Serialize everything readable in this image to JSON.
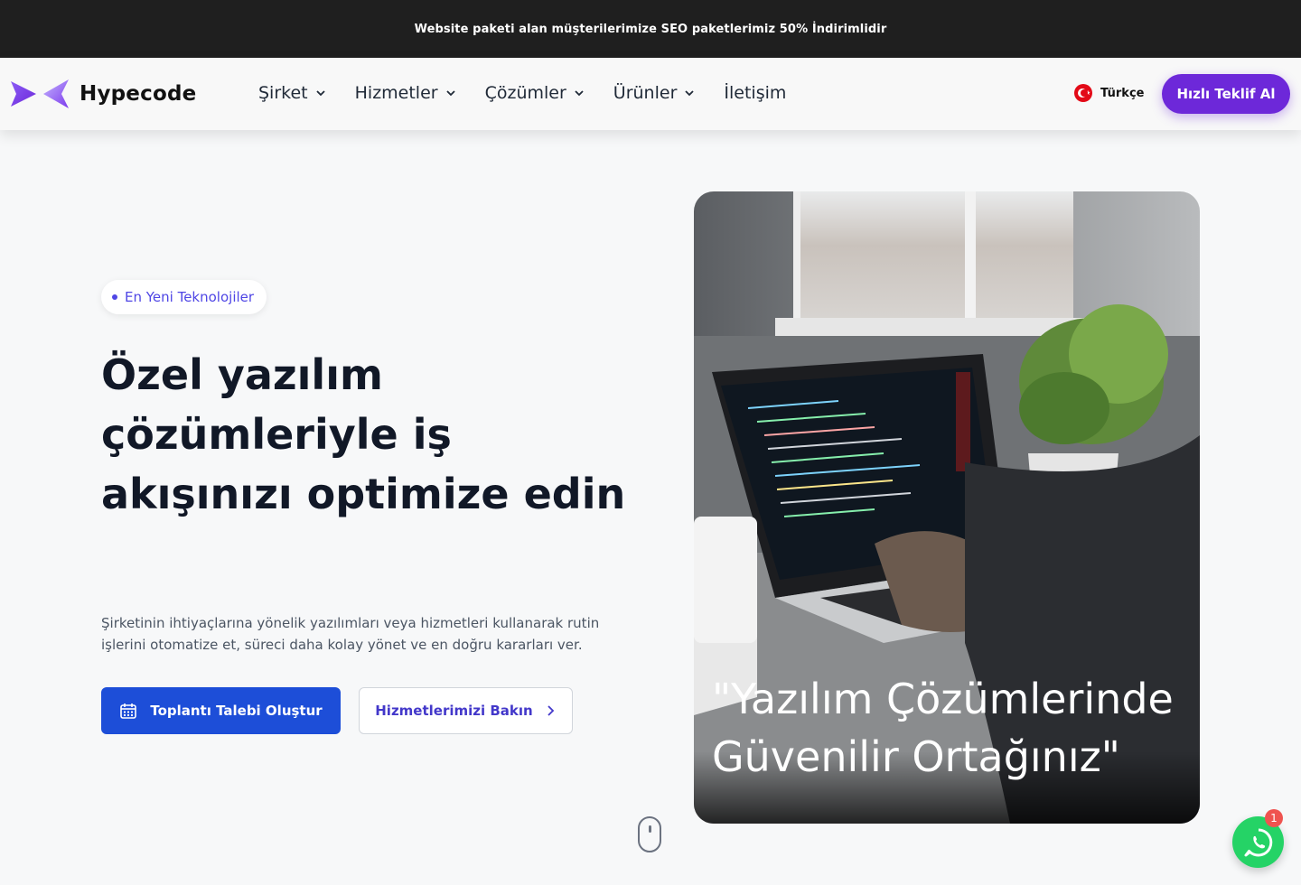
{
  "promo": {
    "text": "Website paketi alan müşterilerimize SEO paketlerimiz 50% İndirimlidir"
  },
  "header": {
    "brand": "Hypecode",
    "menu": [
      {
        "label": "Şirket",
        "has_dropdown": true
      },
      {
        "label": "Hizmetler",
        "has_dropdown": true
      },
      {
        "label": "Çözümler",
        "has_dropdown": true
      },
      {
        "label": "Ürünler",
        "has_dropdown": true
      },
      {
        "label": "İletişim",
        "has_dropdown": false
      }
    ],
    "language": "Türkçe",
    "cta": "Hızlı Teklif Al"
  },
  "hero": {
    "badge": "En Yeni Teknolojiler",
    "title": "Özel yazılım çözümleriyle iş akışınızı optimize edin",
    "description": "Şirketinin ihtiyaçlarına yönelik yazılımları veya hizmetleri kullanarak rutin işlerini otomatize et, süreci daha kolay yönet ve en doğru kararları ver.",
    "primary_button": "Toplantı Talebi Oluştur",
    "secondary_button": "Hizmetlerimizi Bakın",
    "quote": "\"Yazılım Çözümlerinde Güvenilir Ortağınız\""
  },
  "whatsapp": {
    "badge_count": "1"
  },
  "colors": {
    "accent_purple": "#6d28d9",
    "primary_blue": "#1d4ed8",
    "promo_bg": "#1f1f1f",
    "whatsapp_green": "#25d366"
  },
  "icons": [
    "logo-icon",
    "chevron-down-icon",
    "turkey-flag-icon",
    "calendar-icon",
    "chevron-right-icon",
    "mouse-scroll-icon",
    "whatsapp-icon"
  ]
}
